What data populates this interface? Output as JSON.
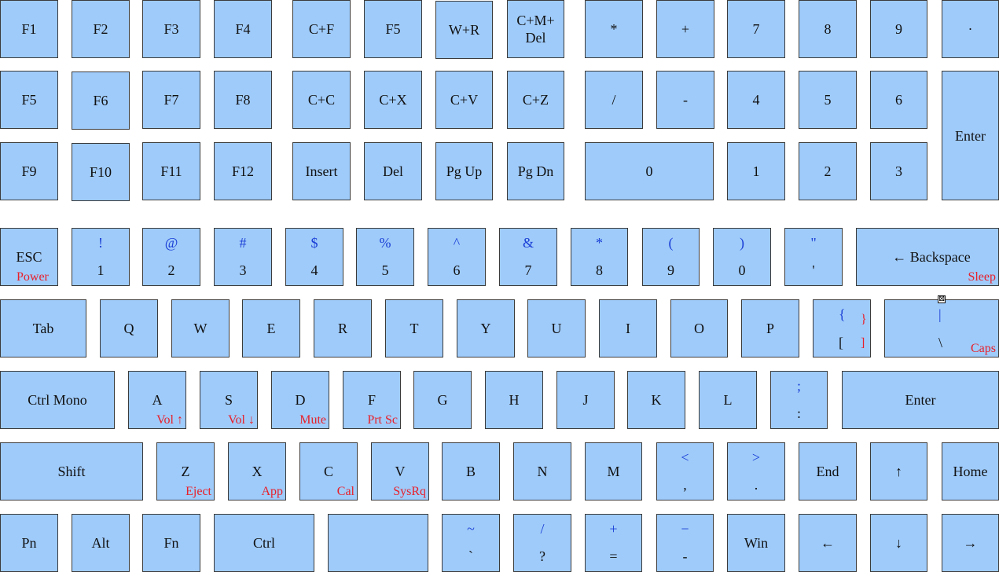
{
  "keys": [
    {
      "id": "f1",
      "main": "F1"
    },
    {
      "id": "f2",
      "main": "F2"
    },
    {
      "id": "f3",
      "main": "F3"
    },
    {
      "id": "f4",
      "main": "F4"
    },
    {
      "id": "cf",
      "main": "C+F"
    },
    {
      "id": "f5a",
      "main": "F5"
    },
    {
      "id": "wr",
      "main": "W+R"
    },
    {
      "id": "cmdel",
      "main": "C+M+\nDel"
    },
    {
      "id": "npstar",
      "main": "*"
    },
    {
      "id": "npplus",
      "main": "+"
    },
    {
      "id": "np7",
      "main": "7"
    },
    {
      "id": "np8",
      "main": "8"
    },
    {
      "id": "np9",
      "main": "9"
    },
    {
      "id": "npdot",
      "main": "·"
    },
    {
      "id": "f5b",
      "main": "F5"
    },
    {
      "id": "f6",
      "main": "F6"
    },
    {
      "id": "f7",
      "main": "F7"
    },
    {
      "id": "f8",
      "main": "F8"
    },
    {
      "id": "cc",
      "main": "C+C"
    },
    {
      "id": "cx",
      "main": "C+X"
    },
    {
      "id": "cv",
      "main": "C+V"
    },
    {
      "id": "cz",
      "main": "C+Z"
    },
    {
      "id": "npslash",
      "main": "/"
    },
    {
      "id": "npminus",
      "main": "-"
    },
    {
      "id": "np4",
      "main": "4"
    },
    {
      "id": "np5",
      "main": "5"
    },
    {
      "id": "np6",
      "main": "6"
    },
    {
      "id": "npenter",
      "main": "Enter"
    },
    {
      "id": "f9",
      "main": "F9"
    },
    {
      "id": "f10",
      "main": "F10"
    },
    {
      "id": "f11",
      "main": "F11"
    },
    {
      "id": "f12",
      "main": "F12"
    },
    {
      "id": "insert",
      "main": "Insert"
    },
    {
      "id": "del",
      "main": "Del"
    },
    {
      "id": "pgup",
      "main": "Pg Up"
    },
    {
      "id": "pgdn",
      "main": "Pg Dn"
    },
    {
      "id": "np0",
      "main": "0"
    },
    {
      "id": "np1",
      "main": "1"
    },
    {
      "id": "np2",
      "main": "2"
    },
    {
      "id": "np3",
      "main": "3"
    },
    {
      "id": "esc",
      "main": "ESC",
      "fn": "Power"
    },
    {
      "id": "k1",
      "top": "!",
      "bottom": "1"
    },
    {
      "id": "k2",
      "top": "@",
      "bottom": "2"
    },
    {
      "id": "k3",
      "top": "#",
      "bottom": "3"
    },
    {
      "id": "k4",
      "top": "$",
      "bottom": "4"
    },
    {
      "id": "k5",
      "top": "%",
      "bottom": "5"
    },
    {
      "id": "k6",
      "top": "^",
      "bottom": "6"
    },
    {
      "id": "k7",
      "top": "&",
      "bottom": "7"
    },
    {
      "id": "k8",
      "top": "*",
      "bottom": "8"
    },
    {
      "id": "k9",
      "top": "(",
      "bottom": "9"
    },
    {
      "id": "k0",
      "top": ")",
      "bottom": "0"
    },
    {
      "id": "kquote",
      "top": "\"",
      "bottom": "'"
    },
    {
      "id": "backspace",
      "main": "← Backspace",
      "fn": "Sleep"
    },
    {
      "id": "tab",
      "main": "Tab"
    },
    {
      "id": "q",
      "main": "Q"
    },
    {
      "id": "w",
      "main": "W"
    },
    {
      "id": "e",
      "main": "E"
    },
    {
      "id": "r",
      "main": "R"
    },
    {
      "id": "t",
      "main": "T"
    },
    {
      "id": "y",
      "main": "Y"
    },
    {
      "id": "u",
      "main": "U"
    },
    {
      "id": "i",
      "main": "I"
    },
    {
      "id": "o",
      "main": "O"
    },
    {
      "id": "p",
      "main": "P"
    },
    {
      "id": "brace",
      "top": "{",
      "bottom": "[",
      "fn_top": "}",
      "fn": "]"
    },
    {
      "id": "pipe",
      "top": "|",
      "bottom": "\\",
      "fn": "Caps",
      "mark": "⊠"
    },
    {
      "id": "ctrlmono",
      "main": "Ctrl Mono"
    },
    {
      "id": "a",
      "main": "A",
      "fn": "Vol ↑"
    },
    {
      "id": "s",
      "main": "S",
      "fn": "Vol ↓"
    },
    {
      "id": "d",
      "main": "D",
      "fn": "Mute"
    },
    {
      "id": "f",
      "main": "F",
      "fn": "Prt Sc"
    },
    {
      "id": "g",
      "main": "G"
    },
    {
      "id": "h",
      "main": "H"
    },
    {
      "id": "j",
      "main": "J"
    },
    {
      "id": "k",
      "main": "K"
    },
    {
      "id": "l",
      "main": "L"
    },
    {
      "id": "semi",
      "top": ";",
      "bottom": ":"
    },
    {
      "id": "enter",
      "main": "Enter"
    },
    {
      "id": "shift",
      "main": "Shift"
    },
    {
      "id": "z",
      "main": "Z",
      "fn": "Eject"
    },
    {
      "id": "x",
      "main": "X",
      "fn": "App"
    },
    {
      "id": "c",
      "main": "C",
      "fn": "Cal"
    },
    {
      "id": "v",
      "main": "V",
      "fn": "SysRq"
    },
    {
      "id": "b",
      "main": "B"
    },
    {
      "id": "n",
      "main": "N"
    },
    {
      "id": "m",
      "main": "M"
    },
    {
      "id": "comma",
      "top": "<",
      "bottom": ","
    },
    {
      "id": "period",
      "top": ">",
      "bottom": "."
    },
    {
      "id": "end",
      "main": "End"
    },
    {
      "id": "up",
      "main": "↑"
    },
    {
      "id": "home",
      "main": "Home"
    },
    {
      "id": "pn",
      "main": "Pn"
    },
    {
      "id": "alt",
      "main": "Alt"
    },
    {
      "id": "fnk",
      "main": "Fn"
    },
    {
      "id": "ctrl",
      "main": "Ctrl"
    },
    {
      "id": "space",
      "main": ""
    },
    {
      "id": "tilde",
      "top": "~",
      "bottom": "`"
    },
    {
      "id": "question",
      "top": "/",
      "bottom": "?"
    },
    {
      "id": "equals",
      "top": "+",
      "bottom": "="
    },
    {
      "id": "minus",
      "top": "−",
      "bottom": "-"
    },
    {
      "id": "win",
      "main": "Win"
    },
    {
      "id": "left",
      "main": "←"
    },
    {
      "id": "down",
      "main": "↓"
    },
    {
      "id": "right",
      "main": "→"
    }
  ]
}
